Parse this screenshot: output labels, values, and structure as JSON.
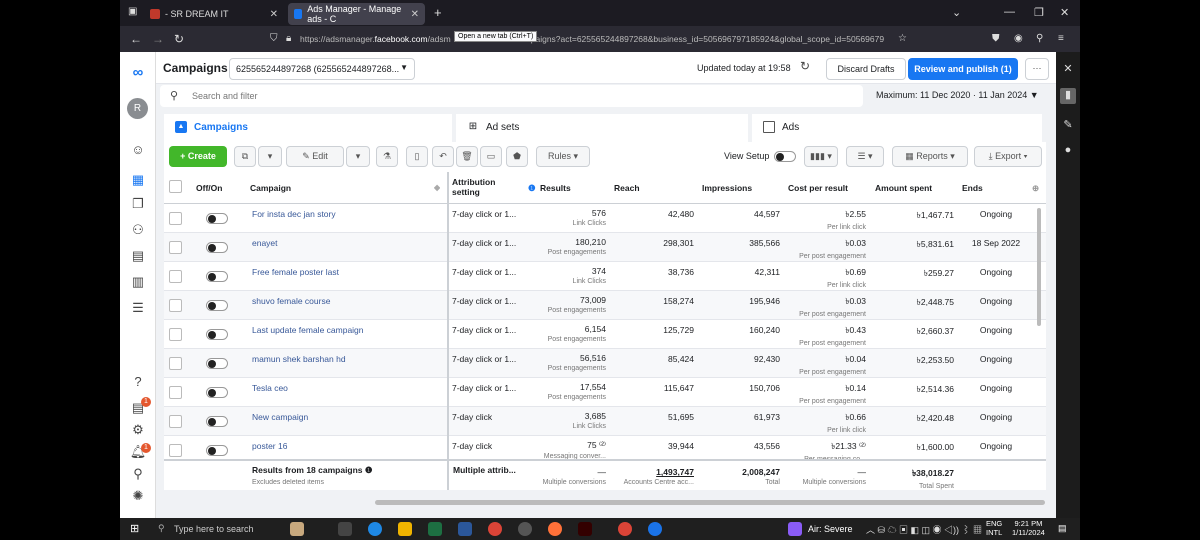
{
  "browser": {
    "tabs": [
      {
        "label": "- SR DREAM IT"
      },
      {
        "label": "Ads Manager - Manage ads - C"
      }
    ],
    "tooltip": "Open a new tab (Ctrl+T)",
    "url_prefix": "https://adsmanager.",
    "url_host": "facebook.com",
    "url_rest": "/adsm",
    "url_tail": "paigns?act=625565244897268&business_id=505696797185924&global_scope_id=50569679"
  },
  "header": {
    "title": "Campaigns",
    "account": "625565244897268 (625565244897268...",
    "updated": "Updated today at 19:58",
    "discard": "Discard Drafts",
    "publish": "Review and publish (1)",
    "more": "···"
  },
  "search": {
    "placeholder": "Search and filter",
    "date_range": "Maximum: 11 Dec 2020 · 11 Jan 2024"
  },
  "level_tabs": [
    {
      "label": "Campaigns"
    },
    {
      "label": "Ad sets"
    },
    {
      "label": "Ads"
    }
  ],
  "toolbar": {
    "create": "+ Create",
    "edit": "Edit",
    "rules": "Rules",
    "view_setup": "View Setup",
    "reports": "Reports",
    "export": "Export"
  },
  "columns": {
    "onoff": "Off/On",
    "campaign": "Campaign",
    "attribution": "Attribution setting",
    "results": "Results",
    "reach": "Reach",
    "impressions": "Impressions",
    "cpr": "Cost per result",
    "spent": "Amount spent",
    "ends": "Ends"
  },
  "rows": [
    {
      "name": "For insta dec jan story",
      "attr": "7-day click or 1...",
      "results": "576",
      "rsub": "Link Clicks",
      "reach": "42,480",
      "impr": "44,597",
      "cpr": "৳2.55",
      "csub": "Per link click",
      "spent": "৳1,467.71",
      "ends": "Ongoing"
    },
    {
      "name": "enayet",
      "attr": "7-day click or 1...",
      "results": "180,210",
      "rsub": "Post engagements",
      "reach": "298,301",
      "impr": "385,566",
      "cpr": "৳0.03",
      "csub": "Per post engagement",
      "spent": "৳5,831.61",
      "ends": "18 Sep 2022"
    },
    {
      "name": "Free female poster last",
      "attr": "7-day click or 1...",
      "results": "374",
      "rsub": "Link Clicks",
      "reach": "38,736",
      "impr": "42,311",
      "cpr": "৳0.69",
      "csub": "Per link click",
      "spent": "৳259.27",
      "ends": "Ongoing"
    },
    {
      "name": "shuvo female course",
      "attr": "7-day click or 1...",
      "results": "73,009",
      "rsub": "Post engagements",
      "reach": "158,274",
      "impr": "195,946",
      "cpr": "৳0.03",
      "csub": "Per post engagement",
      "spent": "৳2,448.75",
      "ends": "Ongoing"
    },
    {
      "name": "Last update female campaign",
      "attr": "7-day click or 1...",
      "results": "6,154",
      "rsub": "Post engagements",
      "reach": "125,729",
      "impr": "160,240",
      "cpr": "৳0.43",
      "csub": "Per post engagement",
      "spent": "৳2,660.37",
      "ends": "Ongoing"
    },
    {
      "name": "mamun shek barshan hd",
      "attr": "7-day click or 1...",
      "results": "56,516",
      "rsub": "Post engagements",
      "reach": "85,424",
      "impr": "92,430",
      "cpr": "৳0.04",
      "csub": "Per post engagement",
      "spent": "৳2,253.50",
      "ends": "Ongoing"
    },
    {
      "name": "Tesla ceo",
      "attr": "7-day click or 1...",
      "results": "17,554",
      "rsub": "Post engagements",
      "reach": "115,647",
      "impr": "150,706",
      "cpr": "৳0.14",
      "csub": "Per post engagement",
      "spent": "৳2,514.36",
      "ends": "Ongoing"
    },
    {
      "name": "New campaign",
      "attr": "7-day click",
      "results": "3,685",
      "rsub": "Link Clicks",
      "reach": "51,695",
      "impr": "61,973",
      "cpr": "৳0.66",
      "csub": "Per link click",
      "spent": "৳2,420.48",
      "ends": "Ongoing"
    },
    {
      "name": "poster 16",
      "attr": "7-day click",
      "results": "75 ⁽²⁾",
      "rsub": "Messaging conver...",
      "reach": "39,944",
      "impr": "43,556",
      "cpr": "৳21.33 ⁽²⁾",
      "csub": "Per messaging co...",
      "spent": "৳1,600.00",
      "ends": "Ongoing"
    }
  ],
  "totals": {
    "name": "Results from 18 campaigns ❶",
    "sub": "Excludes deleted items",
    "attr": "Multiple attrib...",
    "results": "—",
    "rsub": "Multiple conversions",
    "reach": "1,493,747",
    "reach_sub": "Accounts Centre acc...",
    "impr": "2,008,247",
    "impr_sub": "Total",
    "cpr": "—",
    "csub": "Multiple conversions",
    "spent": "৳38,018.27",
    "spent_sub": "Total Spent"
  },
  "taskbar": {
    "search": "Type here to search",
    "weather": "Air: Severe",
    "lang": "ENG",
    "layout": "INTL",
    "time": "9:21 PM",
    "date": "1/11/2024",
    "notif": "3"
  },
  "badges": {
    "a": "1",
    "b": "1"
  },
  "colors": {
    "accent": "#1877f2",
    "create": "#42b72a",
    "link": "#385898"
  }
}
